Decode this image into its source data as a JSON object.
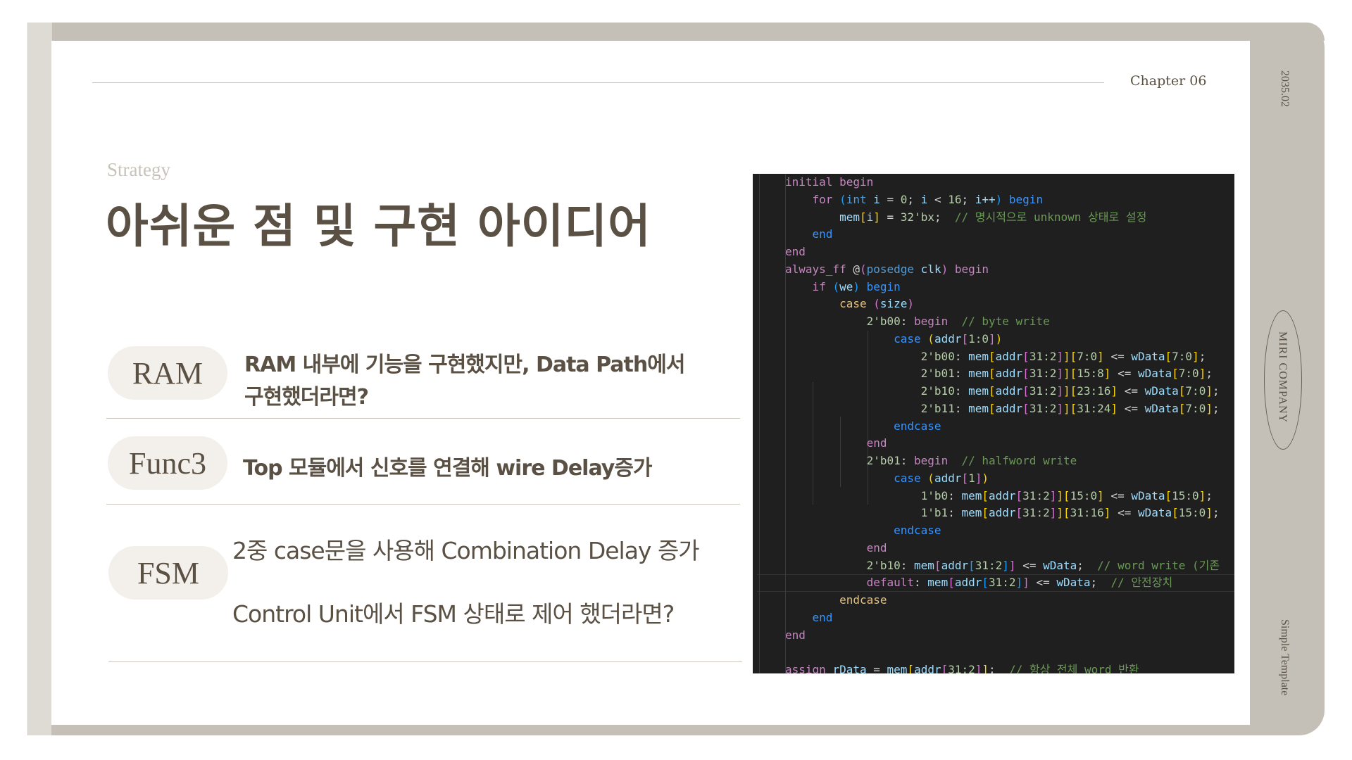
{
  "header": {
    "chapter": "Chapter 06",
    "date": "2035.02"
  },
  "sidebar": {
    "company": "MIRI COMPANY",
    "template": "Simple Template"
  },
  "main": {
    "eyebrow": "Strategy",
    "title": "아쉬운 점 및 구현 아이디어",
    "items": [
      {
        "tag": "RAM",
        "lines": [
          "RAM 내부에 기능을 구현했지만,  Data Path에서",
          "구현했더라면?"
        ]
      },
      {
        "tag": "Func3",
        "lines": [
          "Top 모듈에서 신호를 연결해 wire Delay증가"
        ]
      },
      {
        "tag": "FSM",
        "lines": [
          "2중 case문을 사용해 Combination Delay 증가",
          "Control Unit에서  FSM 상태로 제어 했더라면?"
        ]
      }
    ]
  },
  "colors": {
    "text": "#5a5044",
    "frame": "#c4c0b8",
    "pill": "#f3f0eb",
    "code_bg": "#1f1f1f"
  },
  "code": [
    [
      [
        "initial ",
        "k"
      ],
      [
        "begin",
        "k"
      ]
    ],
    [
      [
        "    ",
        ""
      ],
      [
        "for ",
        "k"
      ],
      [
        "(",
        "u"
      ],
      [
        "int ",
        "t"
      ],
      [
        "i ",
        "v"
      ],
      [
        "= ",
        "p"
      ],
      [
        "0",
        "n"
      ],
      [
        "; ",
        "p"
      ],
      [
        "i ",
        "v"
      ],
      [
        "< ",
        "p"
      ],
      [
        "16",
        "n"
      ],
      [
        "; ",
        "p"
      ],
      [
        "i++",
        "v"
      ],
      [
        ") ",
        "u"
      ],
      [
        "begin",
        "b"
      ]
    ],
    [
      [
        "        ",
        ""
      ],
      [
        "mem",
        "v"
      ],
      [
        "[",
        "g"
      ],
      [
        "i",
        "v"
      ],
      [
        "]",
        "g"
      ],
      [
        " = ",
        "p"
      ],
      [
        "32'bx",
        "n"
      ],
      [
        ";  ",
        "p"
      ],
      [
        "// 명시적으로 unknown 상태로 설정",
        "c"
      ]
    ],
    [
      [
        "    ",
        ""
      ],
      [
        "end",
        "b"
      ]
    ],
    [
      [
        "end",
        "k"
      ]
    ],
    [
      [
        "always_ff ",
        "k"
      ],
      [
        "@",
        "p"
      ],
      [
        "(",
        "m"
      ],
      [
        "posedge ",
        "t"
      ],
      [
        "clk",
        "v"
      ],
      [
        ") ",
        "m"
      ],
      [
        "begin",
        "k"
      ]
    ],
    [
      [
        "    ",
        ""
      ],
      [
        "if ",
        "k"
      ],
      [
        "(",
        "u"
      ],
      [
        "we",
        "v"
      ],
      [
        ") ",
        "u"
      ],
      [
        "begin",
        "b"
      ]
    ],
    [
      [
        "        ",
        ""
      ],
      [
        "case ",
        "y"
      ],
      [
        "(",
        "m"
      ],
      [
        "size",
        "v"
      ],
      [
        ")",
        "m"
      ]
    ],
    [
      [
        "            ",
        ""
      ],
      [
        "2'b00",
        "n"
      ],
      [
        ": ",
        "p"
      ],
      [
        "begin",
        "k"
      ],
      [
        "  // byte write",
        "c"
      ]
    ],
    [
      [
        "                ",
        ""
      ],
      [
        "case ",
        "b"
      ],
      [
        "(",
        "g"
      ],
      [
        "addr",
        "v"
      ],
      [
        "[",
        "m"
      ],
      [
        "1:0",
        "n"
      ],
      [
        "]",
        "m"
      ],
      [
        ")",
        "g"
      ]
    ],
    [
      [
        "                    ",
        ""
      ],
      [
        "2'b00",
        "n"
      ],
      [
        ": ",
        "p"
      ],
      [
        "mem",
        "v"
      ],
      [
        "[",
        "g"
      ],
      [
        "addr",
        "v"
      ],
      [
        "[",
        "m"
      ],
      [
        "31:2",
        "n"
      ],
      [
        "]",
        "m"
      ],
      [
        "]",
        "g"
      ],
      [
        "[",
        "g"
      ],
      [
        "7:0",
        "n"
      ],
      [
        "]",
        "g"
      ],
      [
        " <= ",
        "p"
      ],
      [
        "wData",
        "v"
      ],
      [
        "[",
        "g"
      ],
      [
        "7:0",
        "n"
      ],
      [
        "]",
        "g"
      ],
      [
        ";",
        "p"
      ]
    ],
    [
      [
        "                    ",
        ""
      ],
      [
        "2'b01",
        "n"
      ],
      [
        ": ",
        "p"
      ],
      [
        "mem",
        "v"
      ],
      [
        "[",
        "g"
      ],
      [
        "addr",
        "v"
      ],
      [
        "[",
        "m"
      ],
      [
        "31:2",
        "n"
      ],
      [
        "]",
        "m"
      ],
      [
        "]",
        "g"
      ],
      [
        "[",
        "g"
      ],
      [
        "15:8",
        "n"
      ],
      [
        "]",
        "g"
      ],
      [
        " <= ",
        "p"
      ],
      [
        "wData",
        "v"
      ],
      [
        "[",
        "g"
      ],
      [
        "7:0",
        "n"
      ],
      [
        "]",
        "g"
      ],
      [
        ";",
        "p"
      ]
    ],
    [
      [
        "                    ",
        ""
      ],
      [
        "2'b10",
        "n"
      ],
      [
        ": ",
        "p"
      ],
      [
        "mem",
        "v"
      ],
      [
        "[",
        "g"
      ],
      [
        "addr",
        "v"
      ],
      [
        "[",
        "m"
      ],
      [
        "31:2",
        "n"
      ],
      [
        "]",
        "m"
      ],
      [
        "]",
        "g"
      ],
      [
        "[",
        "g"
      ],
      [
        "23:16",
        "n"
      ],
      [
        "]",
        "g"
      ],
      [
        " <= ",
        "p"
      ],
      [
        "wData",
        "v"
      ],
      [
        "[",
        "g"
      ],
      [
        "7:0",
        "n"
      ],
      [
        "]",
        "g"
      ],
      [
        ";",
        "p"
      ]
    ],
    [
      [
        "                    ",
        ""
      ],
      [
        "2'b11",
        "n"
      ],
      [
        ": ",
        "p"
      ],
      [
        "mem",
        "v"
      ],
      [
        "[",
        "g"
      ],
      [
        "addr",
        "v"
      ],
      [
        "[",
        "m"
      ],
      [
        "31:2",
        "n"
      ],
      [
        "]",
        "m"
      ],
      [
        "]",
        "g"
      ],
      [
        "[",
        "g"
      ],
      [
        "31:24",
        "n"
      ],
      [
        "]",
        "g"
      ],
      [
        " <= ",
        "p"
      ],
      [
        "wData",
        "v"
      ],
      [
        "[",
        "g"
      ],
      [
        "7:0",
        "n"
      ],
      [
        "]",
        "g"
      ],
      [
        ";",
        "p"
      ]
    ],
    [
      [
        "                ",
        ""
      ],
      [
        "endcase",
        "b"
      ]
    ],
    [
      [
        "            ",
        ""
      ],
      [
        "end",
        "k"
      ]
    ],
    [
      [
        "            ",
        ""
      ],
      [
        "2'b01",
        "n"
      ],
      [
        ": ",
        "p"
      ],
      [
        "begin",
        "k"
      ],
      [
        "  // halfword write",
        "c"
      ]
    ],
    [
      [
        "                ",
        ""
      ],
      [
        "case ",
        "b"
      ],
      [
        "(",
        "g"
      ],
      [
        "addr",
        "v"
      ],
      [
        "[",
        "m"
      ],
      [
        "1",
        "n"
      ],
      [
        "]",
        "m"
      ],
      [
        ")",
        "g"
      ]
    ],
    [
      [
        "                    ",
        ""
      ],
      [
        "1'b0",
        "n"
      ],
      [
        ": ",
        "p"
      ],
      [
        "mem",
        "v"
      ],
      [
        "[",
        "g"
      ],
      [
        "addr",
        "v"
      ],
      [
        "[",
        "m"
      ],
      [
        "31:2",
        "n"
      ],
      [
        "]",
        "m"
      ],
      [
        "]",
        "g"
      ],
      [
        "[",
        "g"
      ],
      [
        "15:0",
        "n"
      ],
      [
        "]",
        "g"
      ],
      [
        " <= ",
        "p"
      ],
      [
        "wData",
        "v"
      ],
      [
        "[",
        "g"
      ],
      [
        "15:0",
        "n"
      ],
      [
        "]",
        "g"
      ],
      [
        ";",
        "p"
      ]
    ],
    [
      [
        "                    ",
        ""
      ],
      [
        "1'b1",
        "n"
      ],
      [
        ": ",
        "p"
      ],
      [
        "mem",
        "v"
      ],
      [
        "[",
        "g"
      ],
      [
        "addr",
        "v"
      ],
      [
        "[",
        "m"
      ],
      [
        "31:2",
        "n"
      ],
      [
        "]",
        "m"
      ],
      [
        "]",
        "g"
      ],
      [
        "[",
        "g"
      ],
      [
        "31:16",
        "n"
      ],
      [
        "]",
        "g"
      ],
      [
        " <= ",
        "p"
      ],
      [
        "wData",
        "v"
      ],
      [
        "[",
        "g"
      ],
      [
        "15:0",
        "n"
      ],
      [
        "]",
        "g"
      ],
      [
        ";",
        "p"
      ]
    ],
    [
      [
        "                ",
        ""
      ],
      [
        "endcase",
        "b"
      ]
    ],
    [
      [
        "            ",
        ""
      ],
      [
        "end",
        "k"
      ]
    ],
    [
      [
        "            ",
        ""
      ],
      [
        "2'b10",
        "n"
      ],
      [
        ": ",
        "p"
      ],
      [
        "mem",
        "v"
      ],
      [
        "[",
        "m"
      ],
      [
        "addr",
        "v"
      ],
      [
        "[",
        "u"
      ],
      [
        "31:2",
        "n"
      ],
      [
        "]",
        "u"
      ],
      [
        "]",
        "m"
      ],
      [
        " <= ",
        "p"
      ],
      [
        "wData",
        "v"
      ],
      [
        ";  ",
        "p"
      ],
      [
        "// word write (기존",
        "c"
      ]
    ],
    [
      [
        "            ",
        ""
      ],
      [
        "default",
        "k"
      ],
      [
        ": ",
        "p"
      ],
      [
        "mem",
        "v"
      ],
      [
        "[",
        "m"
      ],
      [
        "addr",
        "v"
      ],
      [
        "[",
        "u"
      ],
      [
        "31:2",
        "n"
      ],
      [
        "]",
        "u"
      ],
      [
        "]",
        "m"
      ],
      [
        " <= ",
        "p"
      ],
      [
        "wData",
        "v"
      ],
      [
        ";  ",
        "p"
      ],
      [
        "// 안전장치",
        "c"
      ]
    ],
    [
      [
        "        ",
        ""
      ],
      [
        "endcase",
        "y"
      ]
    ],
    [
      [
        "    ",
        ""
      ],
      [
        "end",
        "b"
      ]
    ],
    [
      [
        "end",
        "k"
      ]
    ],
    [],
    [
      [
        "assign ",
        "k"
      ],
      [
        "rData",
        "v"
      ],
      [
        " = ",
        "p"
      ],
      [
        "mem",
        "v"
      ],
      [
        "[",
        "g"
      ],
      [
        "addr",
        "v"
      ],
      [
        "[",
        "m"
      ],
      [
        "31:2",
        "n"
      ],
      [
        "]",
        "m"
      ],
      [
        "]",
        "g"
      ],
      [
        ";  ",
        "p"
      ],
      [
        "// 항상 전체 word 반환",
        "c"
      ]
    ]
  ]
}
